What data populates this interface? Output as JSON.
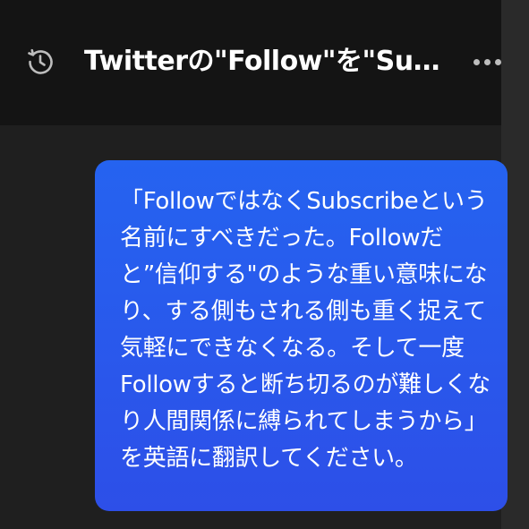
{
  "header": {
    "title": "Twitterの\"Follow\"を\"Subscrib...",
    "history_icon": "history-icon",
    "more_icon": "more-horizontal-icon"
  },
  "message": {
    "text": "「FollowではなくSubscribeという\n名前にすべきだった。Followだ\nと”信仰する\"のような重い意味にな\nり、する側もされる側も重く捉えて\n気軽にできなくなる。そして一度\nFollowすると断ち切るのが難しくな\nり人間関係に縛られてしまうから」\nを英語に翻訳してください。"
  },
  "colors": {
    "bubble": "#2563f0",
    "header_bg": "#141414",
    "background": "#1f1f1f"
  }
}
